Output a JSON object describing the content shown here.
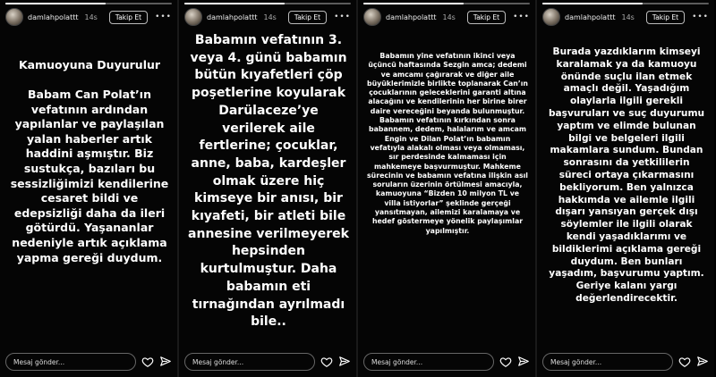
{
  "stories": [
    {
      "username": "damlahpolattt",
      "time": "14s",
      "follow_label": "Takip Et",
      "title": "Kamuoyuna Duyurulur",
      "text": "Babam Can Polat’ın vefatının ardından yapılanlar ve paylaşılan yalan haberler artık haddini aşmıştır. Biz sustukça, bazıları bu sessizliğimizi kendilerine cesaret bildi ve edepsizliği daha da ileri götürdü. Yaşananlar nedeniyle artık açıklama yapma gereği duydum.",
      "message_placeholder": "Mesaj gönder..."
    },
    {
      "username": "damlahpolattt",
      "time": "14s",
      "follow_label": "Takip Et",
      "title": "",
      "text": "Babamın vefatının 3. veya 4. günü babamın bütün kıyafetleri çöp poşetlerine koyularak Darülaceze’ye verilerek aile fertlerine; çocuklar, anne, baba, kardeşler olmak üzere hiç kimseye bir anısı, bir kıyafeti, bir atleti bile annesine verilmeyerek hepsinden kurtulmuştur. Daha babamın eti tırnağından ayrılmadı bile..",
      "message_placeholder": "Mesaj gönder..."
    },
    {
      "username": "damlahpolattt",
      "time": "14s",
      "follow_label": "Takip Et",
      "title": "",
      "text": "Babamın yine vefatının ikinci veya üçüncü haftasında Sezgin amca; dedemi ve amcamı çağırarak ve diğer aile büyüklerimizle birlikte toplanarak Can’ın çocuklarının geleceklerini garanti altına alacağını ve kendilerinin her birine birer daire vereceğini beyanda bulunmuştur. Babamın vefatının kırkından sonra babannem, dedem, halalarım ve amcam Engin ve Dilan Polat’ın babamın vefatıyla alakalı olması veya olmaması, sır perdesinde kalmaması için mahkemeye başvurmuştur. Mahkeme sürecinin ve babamın vefatına ilişkin asıl soruların üzerinin örtülmesi amacıyla, kamuoyuna “Bizden 10 milyon TL ve villa istiyorlar” şeklinde gerçeği yansıtmayan, ailemizi karalamaya ve hedef göstermeye yönelik paylaşımlar yapılmıştır.",
      "message_placeholder": "Mesaj gönder..."
    },
    {
      "username": "damlahpolattt",
      "time": "14s",
      "follow_label": "Takip Et",
      "title": "",
      "text": "Burada yazdıklarım kimseyi karalamak ya da kamuoyu önünde suçlu ilan etmek amaçlı değil. Yaşadığım olaylarla ilgili gerekli başvuruları ve suç duyurumu yaptım ve elimde bulunan bilgi ve belgeleri ilgili makamlara sundum. Bundan sonrasını da yetkililerin süreci ortaya çıkarmasını bekliyorum. Ben yalnızca hakkımda ve ailemle ilgili dışarı yansıyan gerçek dışı söylemler ile ilgili olarak kendi yaşadıklarımı ve bildiklerimi açıklama gereği duydum. Ben bunları yaşadım, başvurumu yaptım. Geriye kalanı yargı değerlendirecektir.",
      "message_placeholder": "Mesaj gönder..."
    }
  ],
  "icons": [
    "heart-icon",
    "send-icon",
    "more-icon"
  ]
}
